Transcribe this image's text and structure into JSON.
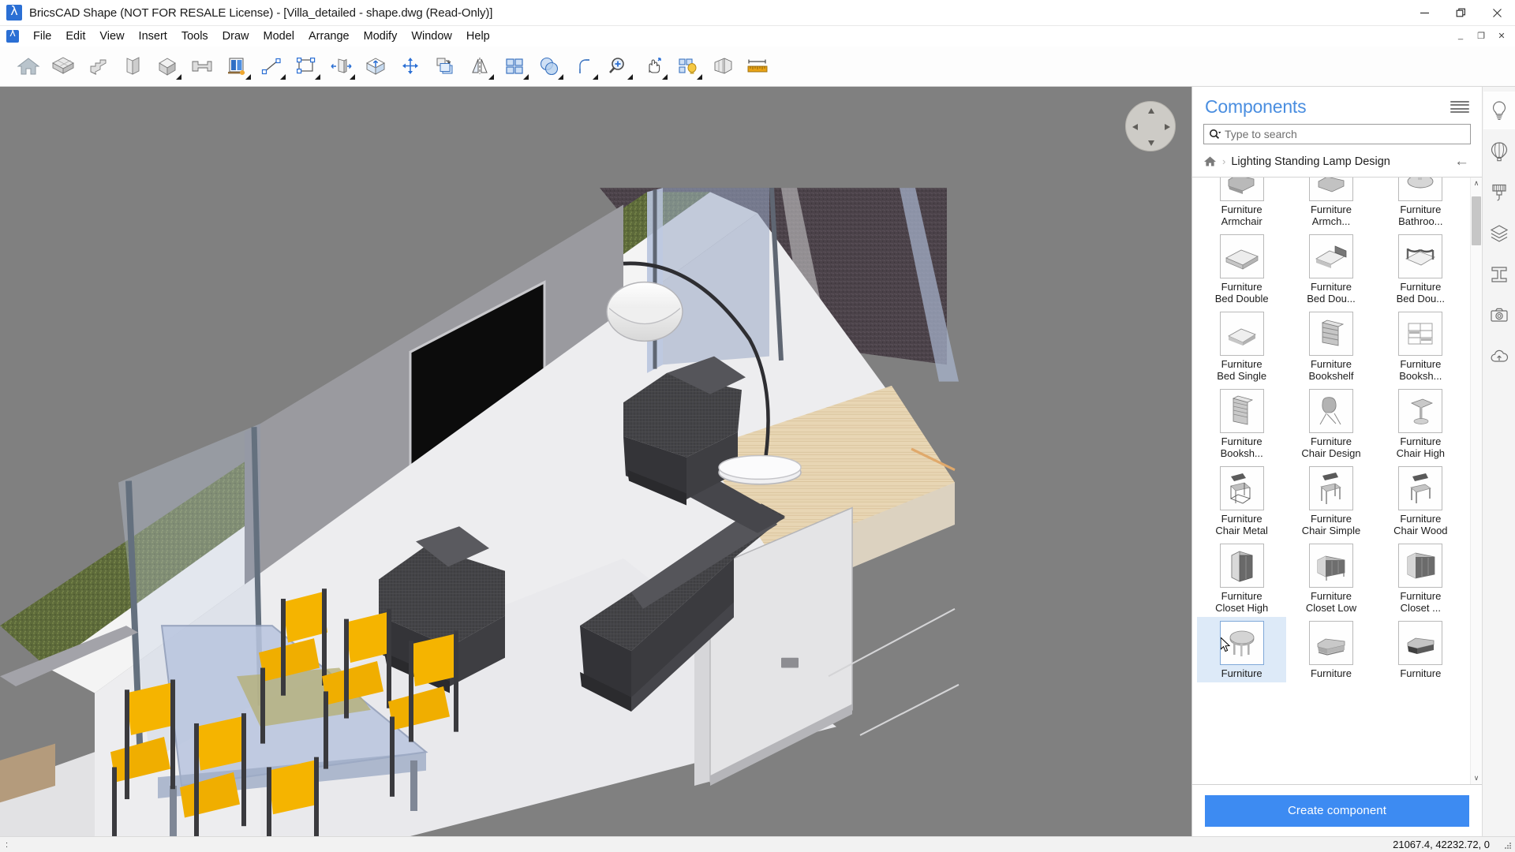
{
  "window": {
    "title": "BricsCAD Shape (NOT FOR RESALE License) - [Villa_detailed - shape.dwg (Read-Only)]",
    "app_logo": "bricscad-logo-icon",
    "controls": {
      "minimize": "minimize-icon",
      "restore": "restore-icon",
      "close": "close-icon"
    },
    "mdi_controls": {
      "minimize": "_",
      "restore": "❐",
      "close": "✕"
    }
  },
  "menubar": {
    "items": [
      "File",
      "Edit",
      "View",
      "Insert",
      "Tools",
      "Draw",
      "Model",
      "Arrange",
      "Modify",
      "Window",
      "Help"
    ]
  },
  "toolbar": {
    "tools": [
      {
        "name": "home-icon",
        "label": "Home",
        "flyout": false
      },
      {
        "name": "wall-stack-icon",
        "label": "Wall",
        "flyout": false
      },
      {
        "name": "stairs-icon",
        "label": "Stairs",
        "flyout": false
      },
      {
        "name": "slab-fold-icon",
        "label": "Slab",
        "flyout": false
      },
      {
        "name": "box-solid-icon",
        "label": "Solid",
        "flyout": true
      },
      {
        "name": "beam-profile-icon",
        "label": "Beam",
        "flyout": false
      },
      {
        "name": "window-door-icon",
        "label": "Window / Door",
        "flyout": true
      },
      {
        "name": "line-icon",
        "label": "Line",
        "flyout": true
      },
      {
        "name": "rectangle-icon",
        "label": "Rectangle",
        "flyout": true
      },
      {
        "name": "push-pull-icon",
        "label": "Push Pull",
        "flyout": true
      },
      {
        "name": "extrude-icon",
        "label": "Extrude",
        "flyout": false
      },
      {
        "name": "move-icon",
        "label": "Move",
        "flyout": false
      },
      {
        "name": "copy-icon",
        "label": "Copy",
        "flyout": false
      },
      {
        "name": "mirror-icon",
        "label": "Mirror",
        "flyout": true
      },
      {
        "name": "array-icon",
        "label": "Array",
        "flyout": true
      },
      {
        "name": "boolean-union-icon",
        "label": "Union",
        "flyout": true
      },
      {
        "name": "fillet-icon",
        "label": "Fillet",
        "flyout": true
      },
      {
        "name": "zoom-in-icon",
        "label": "Zoom",
        "flyout": true
      },
      {
        "name": "pan-icon",
        "label": "Pan",
        "flyout": true
      },
      {
        "name": "component-light-icon",
        "label": "Components",
        "flyout": true
      },
      {
        "name": "section-icon",
        "label": "Section",
        "flyout": false
      },
      {
        "name": "measure-ruler-icon",
        "label": "Measure",
        "flyout": false
      }
    ]
  },
  "panel": {
    "title": "Components",
    "menu_icon": "hamburger-menu-icon",
    "search": {
      "placeholder": "Type to search",
      "value": "",
      "icon": "search-icon"
    },
    "breadcrumb": {
      "home_icon": "home-icon",
      "separator": "›",
      "path": "Lighting Standing Lamp Design",
      "back_icon": "back-arrow-icon"
    },
    "create_button": "Create component",
    "scrollbar": {
      "up": "∧",
      "down": "∨"
    },
    "items": [
      {
        "line1": "Furniture",
        "line2": "Armchair",
        "thumb": "armchair-thumb",
        "selected": false,
        "clipped": true
      },
      {
        "line1": "Furniture",
        "line2": "Armch...",
        "thumb": "armchair-alt-thumb",
        "selected": false,
        "clipped": true
      },
      {
        "line1": "Furniture",
        "line2": "Bathroo...",
        "thumb": "bathroom-thumb",
        "selected": false,
        "clipped": true
      },
      {
        "line1": "Furniture",
        "line2": "Bed Double",
        "thumb": "bed-double-thumb",
        "selected": false,
        "clipped": false
      },
      {
        "line1": "Furniture",
        "line2": "Bed Dou...",
        "thumb": "bed-double-alt-thumb",
        "selected": false,
        "clipped": false
      },
      {
        "line1": "Furniture",
        "line2": "Bed Dou...",
        "thumb": "bed-double-frame-thumb",
        "selected": false,
        "clipped": false
      },
      {
        "line1": "Furniture",
        "line2": "Bed Single",
        "thumb": "bed-single-thumb",
        "selected": false,
        "clipped": false
      },
      {
        "line1": "Furniture",
        "line2": "Bookshelf",
        "thumb": "bookshelf-thumb",
        "selected": false,
        "clipped": false
      },
      {
        "line1": "Furniture",
        "line2": "Booksh...",
        "thumb": "bookshelf-open-thumb",
        "selected": false,
        "clipped": false
      },
      {
        "line1": "Furniture",
        "line2": "Booksh...",
        "thumb": "bookshelf-tall-thumb",
        "selected": false,
        "clipped": false
      },
      {
        "line1": "Furniture",
        "line2": "Chair Design",
        "thumb": "chair-design-thumb",
        "selected": false,
        "clipped": false
      },
      {
        "line1": "Furniture",
        "line2": "Chair High",
        "thumb": "chair-high-thumb",
        "selected": false,
        "clipped": false
      },
      {
        "line1": "Furniture",
        "line2": "Chair Metal",
        "thumb": "chair-metal-thumb",
        "selected": false,
        "clipped": false
      },
      {
        "line1": "Furniture",
        "line2": "Chair Simple",
        "thumb": "chair-simple-thumb",
        "selected": false,
        "clipped": false
      },
      {
        "line1": "Furniture",
        "line2": "Chair Wood",
        "thumb": "chair-wood-thumb",
        "selected": false,
        "clipped": false
      },
      {
        "line1": "Furniture",
        "line2": "Closet High",
        "thumb": "closet-high-thumb",
        "selected": false,
        "clipped": false
      },
      {
        "line1": "Furniture",
        "line2": "Closet Low",
        "thumb": "closet-low-thumb",
        "selected": false,
        "clipped": false
      },
      {
        "line1": "Furniture",
        "line2": "Closet ...",
        "thumb": "closet-wide-thumb",
        "selected": false,
        "clipped": false
      },
      {
        "line1": "Furniture",
        "line2": "",
        "thumb": "coffee-table-thumb",
        "selected": true,
        "clipped": false
      },
      {
        "line1": "Furniture",
        "line2": "",
        "thumb": "couch-thumb",
        "selected": false,
        "clipped": false
      },
      {
        "line1": "Furniture",
        "line2": "",
        "thumb": "couch-alt-thumb",
        "selected": false,
        "clipped": false
      }
    ]
  },
  "rail": {
    "items": [
      {
        "name": "light-bulb-icon",
        "label": "Lights",
        "active": true
      },
      {
        "name": "hot-air-balloon-icon",
        "label": "Sky / Environment",
        "active": false
      },
      {
        "name": "paint-brush-icon",
        "label": "Materials",
        "active": false
      },
      {
        "name": "layers-icon",
        "label": "Layers",
        "active": false
      },
      {
        "name": "i-beam-icon",
        "label": "Profiles",
        "active": false
      },
      {
        "name": "camera-icon",
        "label": "Views / Render",
        "active": false
      },
      {
        "name": "cloud-upload-icon",
        "label": "Cloud",
        "active": false
      }
    ]
  },
  "statusbar": {
    "prompt": ":",
    "coordinates": "21067.4, 42232.72, 0",
    "grip": "resize-grip-icon"
  },
  "viewport": {
    "name": "3d-model-viewport",
    "scene": "Villa interior living room with armchairs, sofa, TV wall, standing lamp, dining table with yellow chairs, glass facade and green roof",
    "navigation_widget": "look-around-compass-icon",
    "colors": {
      "sky": "#808080",
      "floor": "#ededef",
      "wall": "#9a9a9f",
      "grass": "#5d6a3a",
      "gravel": "#4a4247",
      "furniture_dark": "#3f3f42",
      "chair_yellow": "#f5b400",
      "glass_blue": "#b9c5df",
      "wood": "#e6d3b1"
    }
  }
}
